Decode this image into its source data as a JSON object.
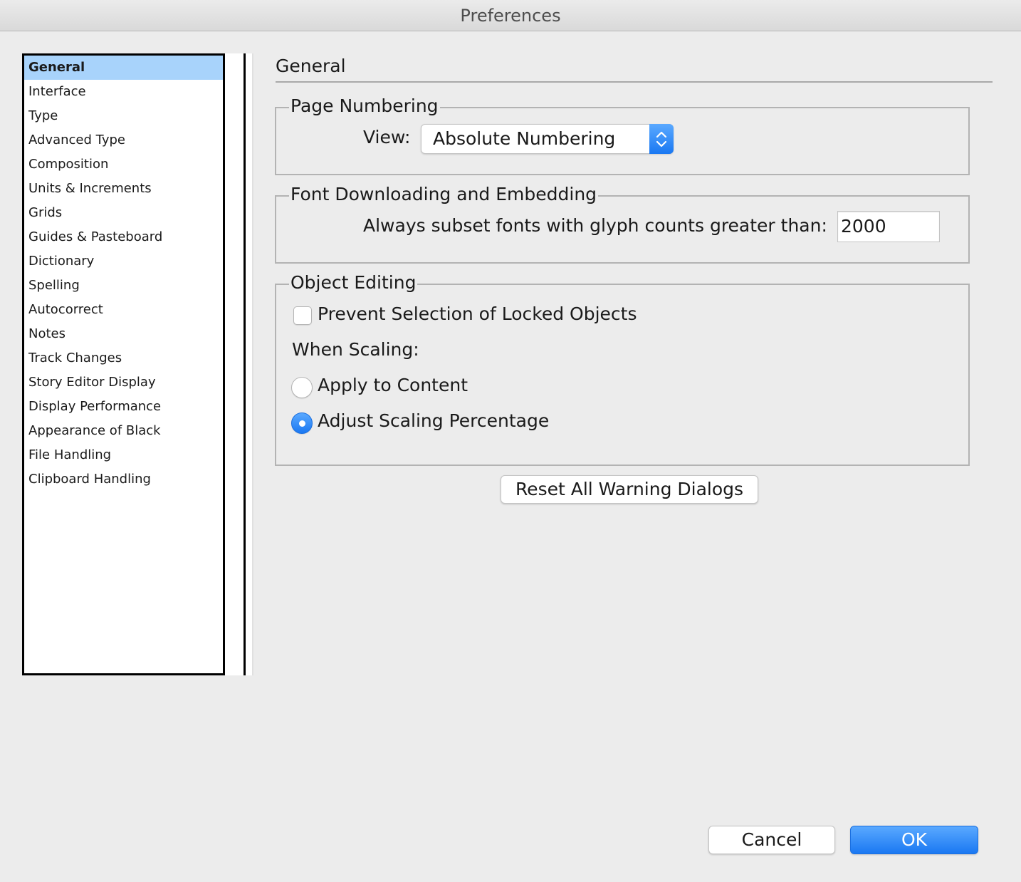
{
  "window": {
    "title": "Preferences"
  },
  "sidebar": {
    "selected": "General",
    "items": [
      "General",
      "Interface",
      "Type",
      "Advanced Type",
      "Composition",
      "Units & Increments",
      "Grids",
      "Guides & Pasteboard",
      "Dictionary",
      "Spelling",
      "Autocorrect",
      "Notes",
      "Track Changes",
      "Story Editor Display",
      "Display Performance",
      "Appearance of Black",
      "File Handling",
      "Clipboard Handling"
    ]
  },
  "panel": {
    "title": "General",
    "page_numbering": {
      "label": "Page Numbering",
      "view_label": "View:",
      "view_value": "Absolute Numbering"
    },
    "font_downloading": {
      "label": "Font Downloading and Embedding",
      "subset_label": "Always subset fonts with glyph counts greater than:",
      "subset_value": "2000"
    },
    "object_editing": {
      "label": "Object Editing",
      "prevent_selection_label": "Prevent Selection of Locked Objects",
      "prevent_selection_checked": false,
      "when_scaling_label": "When Scaling:",
      "apply_to_content_label": "Apply to Content",
      "adjust_scaling_label": "Adjust Scaling Percentage",
      "selected_option": "Adjust Scaling Percentage"
    },
    "reset_button_label": "Reset All Warning Dialogs"
  },
  "footer": {
    "cancel_label": "Cancel",
    "ok_label": "OK"
  },
  "colors": {
    "accent": "#1a78f2",
    "selection": "#a8d3fb",
    "window_bg": "#ececec"
  }
}
